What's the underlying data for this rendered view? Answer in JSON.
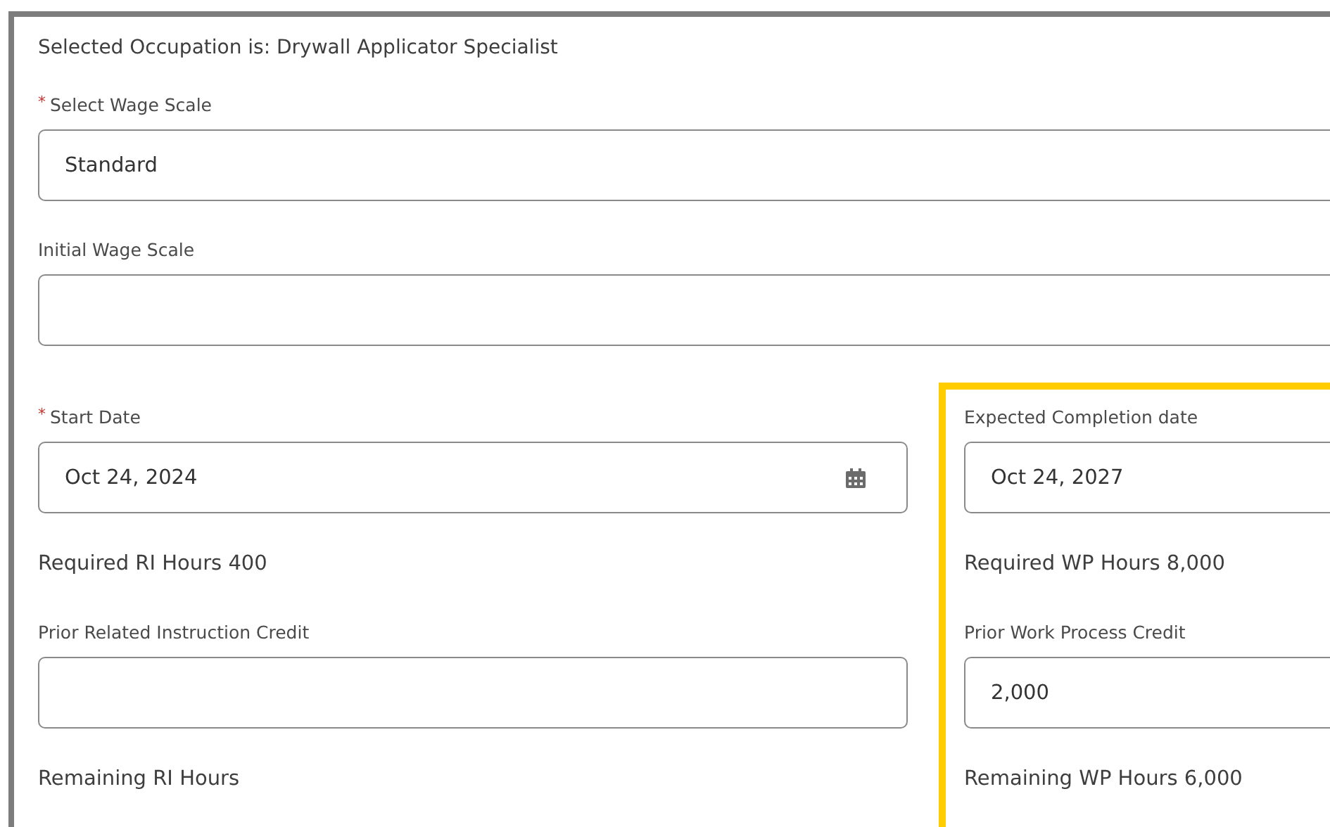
{
  "heading": "Selected Occupation is: Drywall Applicator Specialist",
  "top_fields": [
    {
      "label": "Select Wage Scale",
      "required_mark": "*",
      "value": "Standard"
    },
    {
      "label": "Initial Wage Scale"
    }
  ],
  "columns": [
    {
      "highlighted": false,
      "items": [
        {
          "kind": "date_field",
          "label": "Start Date",
          "required_mark": "*",
          "value": "Oct 24, 2024"
        },
        {
          "kind": "text",
          "text": "Required RI Hours 400"
        },
        {
          "kind": "field",
          "label": "Prior Related Instruction Credit"
        },
        {
          "kind": "text",
          "text": "Remaining RI Hours"
        }
      ]
    },
    {
      "highlighted": true,
      "items": [
        {
          "kind": "field",
          "label": "Expected Completion date",
          "value": "Oct 24, 2027"
        },
        {
          "kind": "text",
          "text": "Required WP Hours 8,000"
        },
        {
          "kind": "field",
          "label": "Prior Work Process Credit",
          "value": "2,000"
        },
        {
          "kind": "text",
          "text": "Remaining WP Hours 6,000"
        }
      ]
    }
  ]
}
